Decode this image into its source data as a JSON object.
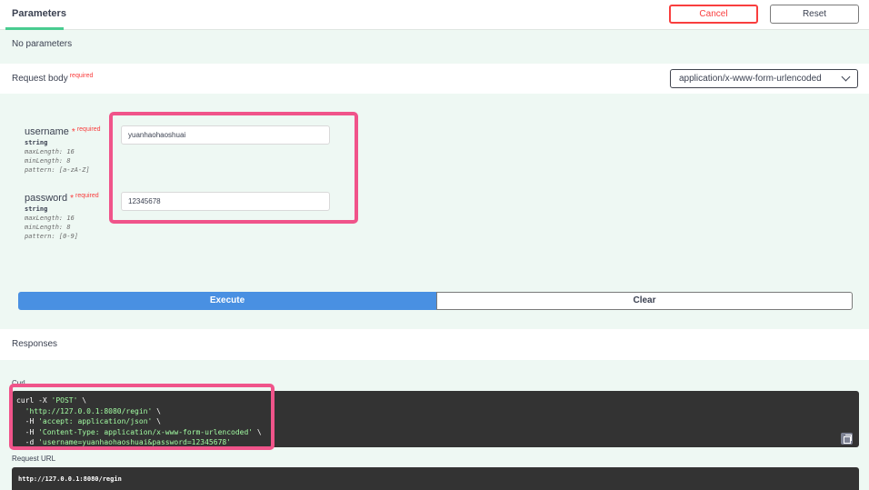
{
  "parameters": {
    "tab_label": "Parameters",
    "cancel_label": "Cancel",
    "reset_label": "Reset",
    "empty_text": "No parameters"
  },
  "request_body": {
    "title": "Request body",
    "required_label": "required",
    "content_type": "application/x-www-form-urlencoded",
    "fields": [
      {
        "name": "username",
        "required_label": "required",
        "type": "string",
        "meta": [
          "maxLength: 16",
          "minLength: 8",
          "pattern: [a-zA-Z]"
        ],
        "value": "yuanhaohaoshuai"
      },
      {
        "name": "password",
        "required_label": "required",
        "type": "string",
        "meta": [
          "maxLength: 16",
          "minLength: 8",
          "pattern: [0-9]"
        ],
        "value": "12345678"
      }
    ]
  },
  "actions": {
    "execute_label": "Execute",
    "clear_label": "Clear"
  },
  "responses": {
    "title": "Responses",
    "curl_label": "Curl",
    "curl_lines": [
      {
        "plain": "curl -X ",
        "str": "'POST'",
        "tail": " \\"
      },
      {
        "plain": "  ",
        "str": "'http://127.0.0.1:8080/regin'",
        "tail": " \\"
      },
      {
        "plain": "  -H ",
        "str": "'accept: application/json'",
        "tail": " \\"
      },
      {
        "plain": "  -H ",
        "str": "'Content-Type: application/x-www-form-urlencoded'",
        "tail": " \\"
      },
      {
        "plain": "  -d ",
        "str": "'username=yuanhaohaoshuai&password=12345678'",
        "tail": ""
      }
    ],
    "request_url_label": "Request URL",
    "request_url": "http://127.0.0.1:8080/regin"
  },
  "colors": {
    "execute": "#4990e2",
    "cancel": "#f93e3e",
    "highlight": "#f0548a",
    "tab_underline": "#49cc90"
  },
  "icons": {
    "copy": "copy-icon",
    "dropdown": "chevron-down-icon"
  }
}
